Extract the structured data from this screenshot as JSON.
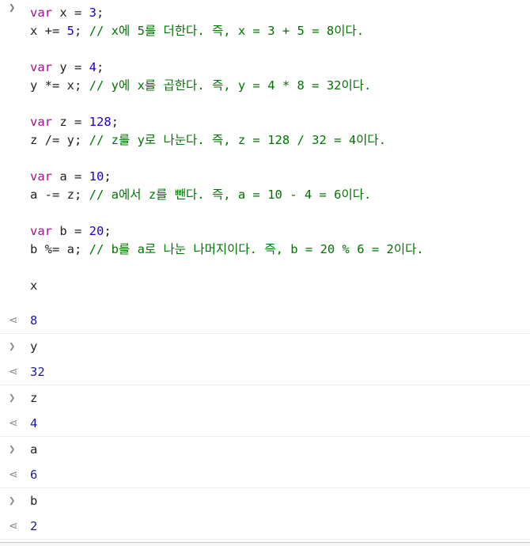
{
  "input_block": {
    "lines": [
      {
        "p1": "var",
        "p2": " x = ",
        "p3": "3",
        "p4": ";",
        "p5": ""
      },
      {
        "p1": "",
        "p2": "x += ",
        "p3": "5",
        "p4": "; ",
        "p5": "// x에 5를 더한다. 즉, x = 3 + 5 = 8이다."
      },
      {
        "p1": "var",
        "p2": " y = ",
        "p3": "4",
        "p4": ";",
        "p5": ""
      },
      {
        "p1": "",
        "p2": "y *= x; ",
        "p3": "",
        "p4": "",
        "p5": "// y에 x를 곱한다. 즉, y = 4 * 8 = 32이다."
      },
      {
        "p1": "var",
        "p2": " z = ",
        "p3": "128",
        "p4": ";",
        "p5": ""
      },
      {
        "p1": "",
        "p2": "z /= y; ",
        "p3": "",
        "p4": "",
        "p5": "// z를 y로 나눈다. 즉, z = 128 / 32 = 4이다."
      },
      {
        "p1": "var",
        "p2": " a = ",
        "p3": "10",
        "p4": ";",
        "p5": ""
      },
      {
        "p1": "",
        "p2": "a -= z; ",
        "p3": "",
        "p4": "",
        "p5": "// a에서 z를 뺀다. 즉, a = 10 - 4 = 6이다."
      },
      {
        "p1": "var",
        "p2": " b = ",
        "p3": "20",
        "p4": ";",
        "p5": ""
      },
      {
        "p1": "",
        "p2": "b %= a; ",
        "p3": "",
        "p4": "",
        "p5": "// b를 a로 나눈 나머지이다. 즉, b = 20 % 6 = 2이다."
      },
      {
        "p1": "",
        "p2": "x",
        "p3": "",
        "p4": "",
        "p5": ""
      }
    ]
  },
  "entries": [
    {
      "kind": "result",
      "text": "8"
    },
    {
      "kind": "input",
      "text": "y"
    },
    {
      "kind": "result",
      "text": "32"
    },
    {
      "kind": "input",
      "text": "z"
    },
    {
      "kind": "result",
      "text": "4"
    },
    {
      "kind": "input",
      "text": "a"
    },
    {
      "kind": "result",
      "text": "6"
    },
    {
      "kind": "input",
      "text": "b"
    },
    {
      "kind": "result",
      "text": "2"
    }
  ],
  "icons": {
    "input_prompt": "chevron-right-icon",
    "result_prompt": "return-arrow-icon"
  },
  "glyphs": {
    "input": "❯",
    "result": "⋖"
  }
}
